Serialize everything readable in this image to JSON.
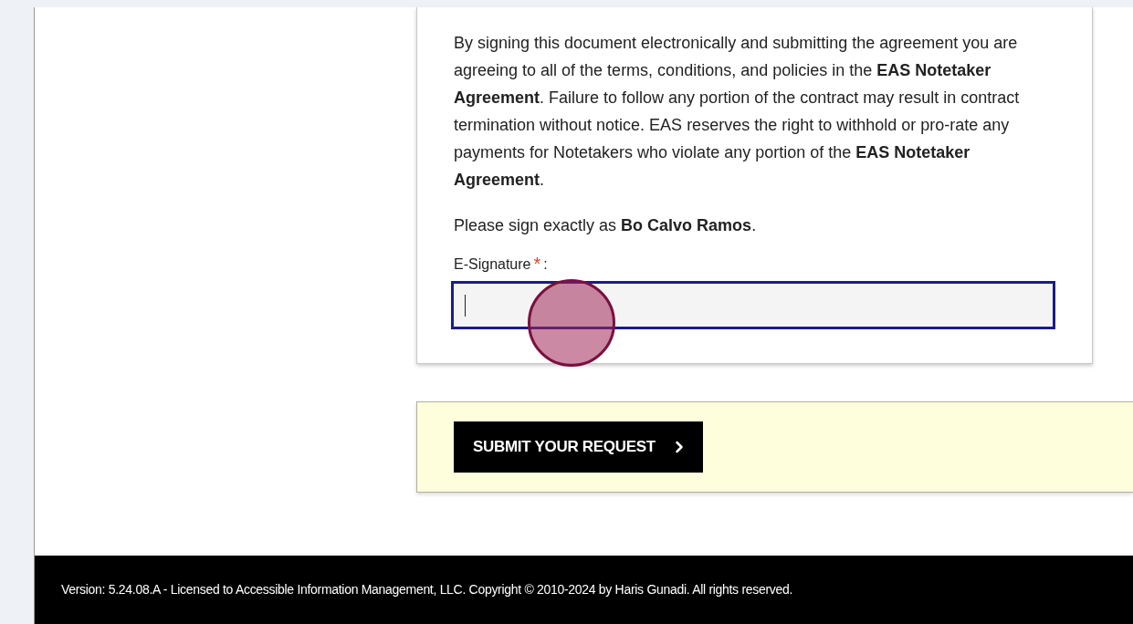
{
  "agreement": {
    "paragraph": "By signing this document electronically and submitting the agreement you are agreeing to all of the terms, conditions, and policies in the **EAS Notetaker Agreement**. Failure to follow any portion of the contract may result in contract termination without notice. EAS reserves the right to withhold or pro-rate any payments for Notetakers who violate any portion of the **EAS Notetaker Agreement**.",
    "sign_instruction": "Please sign exactly as **Bo Calvo Ramos**."
  },
  "signature_field": {
    "label": "E-Signature",
    "required": true,
    "required_mark": "*",
    "label_suffix": ":",
    "focused": true
  },
  "submit_button": {
    "label": "SUBMIT YOUR REQUEST"
  },
  "footer": {
    "text": "Version: 5.24.08.A - Licensed to Accessible Information Management, LLC. Copyright © 2010-2024 by Haris Gunadi. All rights reserved."
  }
}
